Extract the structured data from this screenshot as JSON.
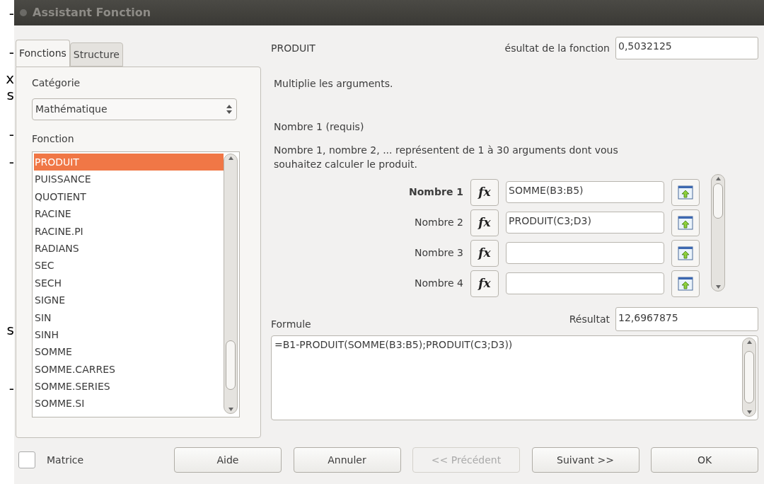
{
  "background_fragments": [
    "-",
    "-",
    "x",
    "s",
    "-",
    "-",
    "s",
    "-"
  ],
  "window": {
    "title": "Assistant Fonction"
  },
  "tabs": [
    {
      "label": "Fonctions",
      "selected": true
    },
    {
      "label": "Structure",
      "selected": false
    }
  ],
  "category": {
    "label": "Catégorie",
    "value": "Mathématique"
  },
  "function_list": {
    "label": "Fonction",
    "items": [
      {
        "label": "PRODUIT",
        "selected": true
      },
      {
        "label": "PUISSANCE",
        "selected": false
      },
      {
        "label": "QUOTIENT",
        "selected": false
      },
      {
        "label": "RACINE",
        "selected": false
      },
      {
        "label": "RACINE.PI",
        "selected": false
      },
      {
        "label": "RADIANS",
        "selected": false
      },
      {
        "label": "SEC",
        "selected": false
      },
      {
        "label": "SECH",
        "selected": false
      },
      {
        "label": "SIGNE",
        "selected": false
      },
      {
        "label": "SIN",
        "selected": false
      },
      {
        "label": "SINH",
        "selected": false
      },
      {
        "label": "SOMME",
        "selected": false
      },
      {
        "label": "SOMME.CARRES",
        "selected": false
      },
      {
        "label": "SOMME.SERIES",
        "selected": false
      },
      {
        "label": "SOMME.SI",
        "selected": false
      }
    ]
  },
  "function_name": "PRODUIT",
  "function_result": {
    "label": "ésultat de la fonction",
    "value": "0,5032125"
  },
  "description": "Multiplie les arguments.",
  "argument_title": "Nombre 1 (requis)",
  "argument_help": "Nombre 1, nombre 2, ... représentent de 1 à 30 arguments dont vous souhaitez calculer le produit.",
  "arguments": [
    {
      "label": "Nombre 1",
      "fx": "fx",
      "value": "SOMME(B3:B5)",
      "selected": true
    },
    {
      "label": "Nombre 2",
      "fx": "fx",
      "value": "PRODUIT(C3;D3)",
      "selected": false
    },
    {
      "label": "Nombre 3",
      "fx": "fx",
      "selected": false
    },
    {
      "label": "Nombre 4",
      "fx": "fx",
      "selected": false
    }
  ],
  "formula": {
    "label": "Formule",
    "value": "=B1-PRODUIT(SOMME(B3:B5);PRODUIT(C3;D3))"
  },
  "result": {
    "label": "Résultat",
    "value": "12,6967875"
  },
  "matrix": {
    "label": "Matrice",
    "checked": false
  },
  "buttons": [
    {
      "label": "Aide",
      "disabled": false
    },
    {
      "label": "Annuler",
      "disabled": false
    },
    {
      "label": "<< Précédent",
      "disabled": true
    },
    {
      "label": "Suivant >>",
      "disabled": false
    },
    {
      "label": "OK",
      "disabled": false
    }
  ]
}
